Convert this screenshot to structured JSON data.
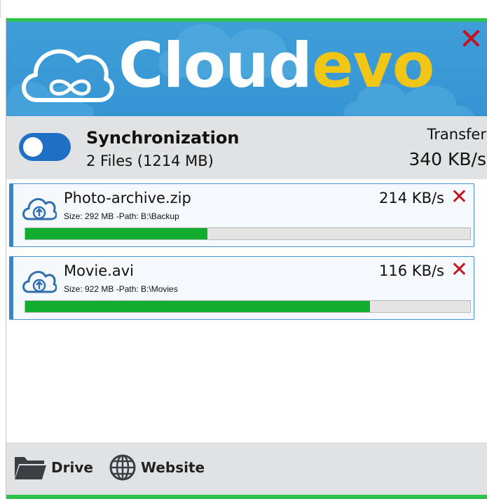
{
  "app": {
    "brand_part1": "Cloud",
    "brand_part2": "evo",
    "close_label": "✕",
    "colors": {
      "brand_yellow": "#f1c617",
      "header_blue": "#3a9ad6",
      "accent_green": "#2fc24a",
      "close_red": "#c4121f",
      "progress_green": "#10ad2e"
    }
  },
  "sync": {
    "title": "Synchronization",
    "files_summary": "2 Files (1214 MB)",
    "toggle_state": "on",
    "transfer_label": "Transfer",
    "transfer_value": "340 KB/s"
  },
  "transfers": [
    {
      "name": "Photo-archive.zip",
      "meta": "Size: 292 MB -Path: B:\\Backup",
      "speed": "214 KB/s",
      "progress": 0.41,
      "remove_label": "✕",
      "icon": "cloud-upload-icon"
    },
    {
      "name": "Movie.avi",
      "meta": "Size: 922 MB -Path: B:\\Movies",
      "speed": "116 KB/s",
      "progress": 0.775,
      "remove_label": "✕",
      "icon": "cloud-upload-icon"
    }
  ],
  "footer": {
    "drive_label": "Drive",
    "drive_icon": "folder-icon",
    "website_label": "Website",
    "website_icon": "globe-icon"
  }
}
